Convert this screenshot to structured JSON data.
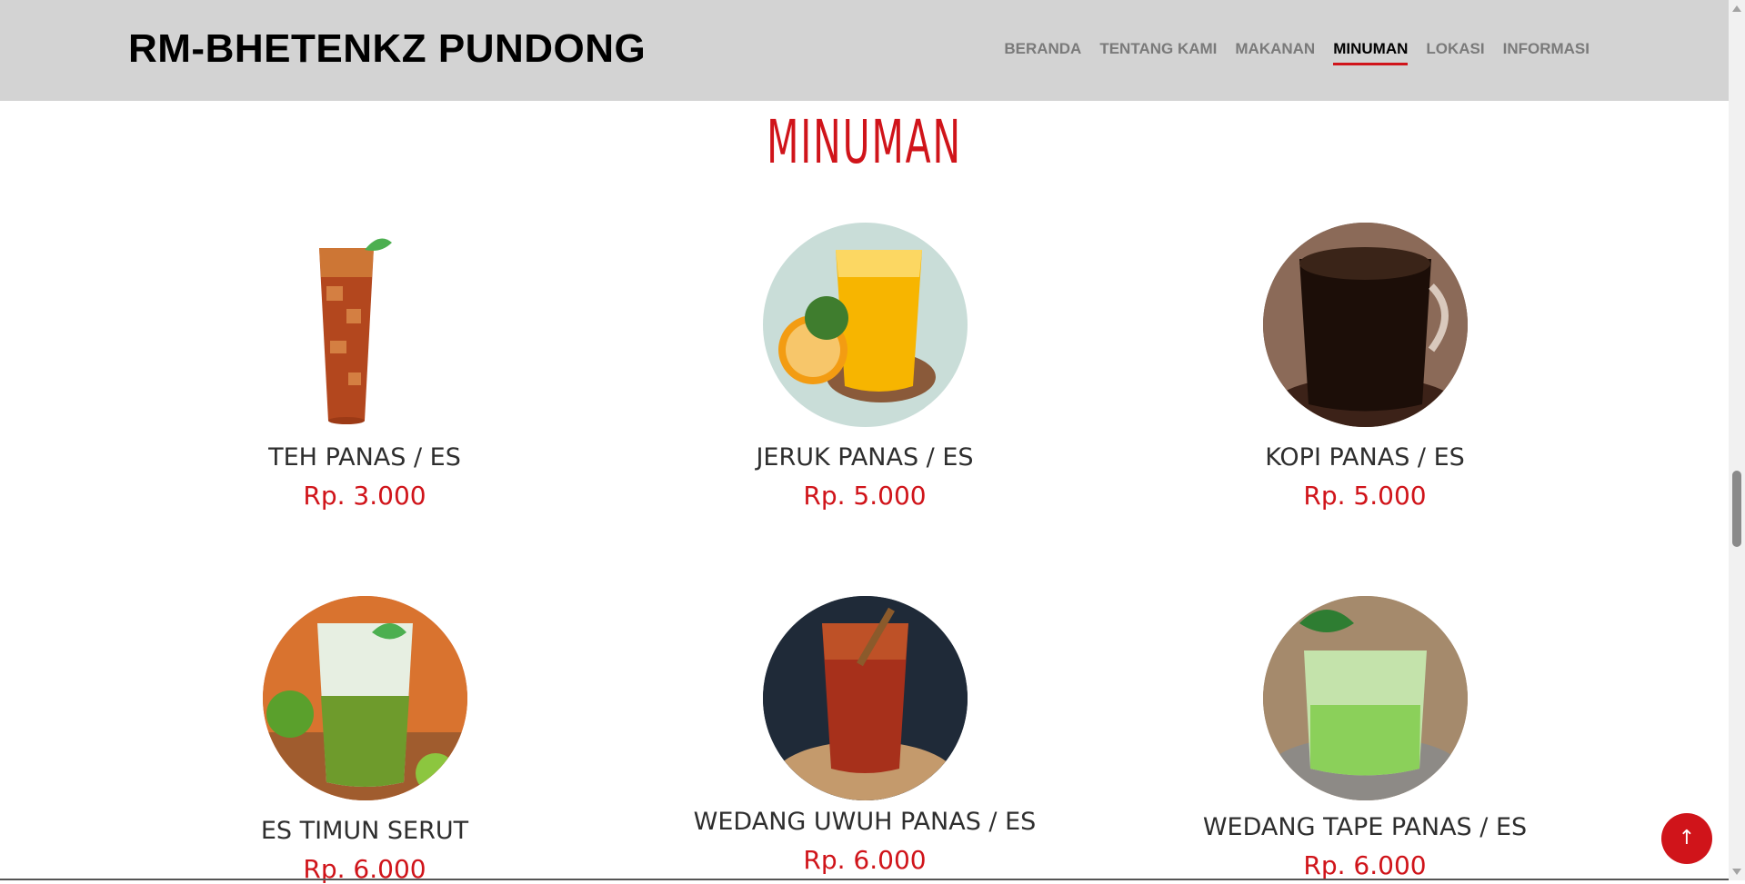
{
  "header": {
    "brand": "RM-BHETENKZ PUNDONG",
    "nav": [
      {
        "label": "BERANDA",
        "active": false
      },
      {
        "label": "TENTANG KAMI",
        "active": false
      },
      {
        "label": "MAKANAN",
        "active": false
      },
      {
        "label": "MINUMAN",
        "active": true
      },
      {
        "label": "LOKASI",
        "active": false
      },
      {
        "label": "INFORMASI",
        "active": false
      }
    ]
  },
  "section": {
    "title": "MINUMAN"
  },
  "items": [
    {
      "name": "TEH PANAS / ES",
      "price": "Rp. 3.000"
    },
    {
      "name": "JERUK PANAS / ES",
      "price": "Rp. 5.000"
    },
    {
      "name": "KOPI PANAS / ES",
      "price": "Rp. 5.000"
    },
    {
      "name": "ES TIMUN SERUT",
      "price": "Rp. 6.000"
    },
    {
      "name": "WEDANG UWUH PANAS / ES",
      "price": "Rp. 6.000"
    },
    {
      "name": "WEDANG TAPE PANAS / ES",
      "price": "Rp. 6.000"
    }
  ],
  "back_to_top": {
    "icon": "arrow-up-icon",
    "glyph": "↑"
  },
  "colors": {
    "accent": "#d0141a",
    "header_bg": "#d3d3d3"
  }
}
